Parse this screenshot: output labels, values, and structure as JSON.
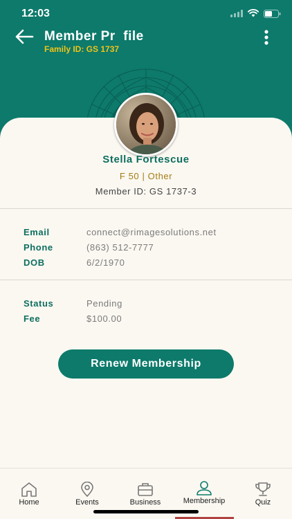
{
  "status_bar": {
    "time": "12:03"
  },
  "header": {
    "title": "Member Pr  file",
    "subtitle": "Family ID: GS 1737",
    "colors": {
      "primary": "#0d7a6b",
      "accent": "#f0c419"
    }
  },
  "profile": {
    "name": "Stella Fortescue",
    "meta": "F 50 | Other",
    "member_id": "Member ID: GS 1737-3"
  },
  "contact": [
    {
      "label": "Email",
      "value": "connect@rimagesolutions.net"
    },
    {
      "label": "Phone",
      "value": "(863) 512-7777"
    },
    {
      "label": "DOB",
      "value": "6/2/1970"
    }
  ],
  "membership": [
    {
      "label": "Status",
      "value": "Pending"
    },
    {
      "label": "Fee",
      "value": "$100.00"
    }
  ],
  "actions": {
    "renew_label": "Renew Membership"
  },
  "tabs": [
    {
      "label": "Home",
      "icon": "home-icon"
    },
    {
      "label": "Events",
      "icon": "location-pin-icon"
    },
    {
      "label": "Business",
      "icon": "briefcase-icon"
    },
    {
      "label": "Membership",
      "icon": "person-icon"
    },
    {
      "label": "Quiz",
      "icon": "trophy-icon"
    }
  ],
  "active_tab": "Membership"
}
